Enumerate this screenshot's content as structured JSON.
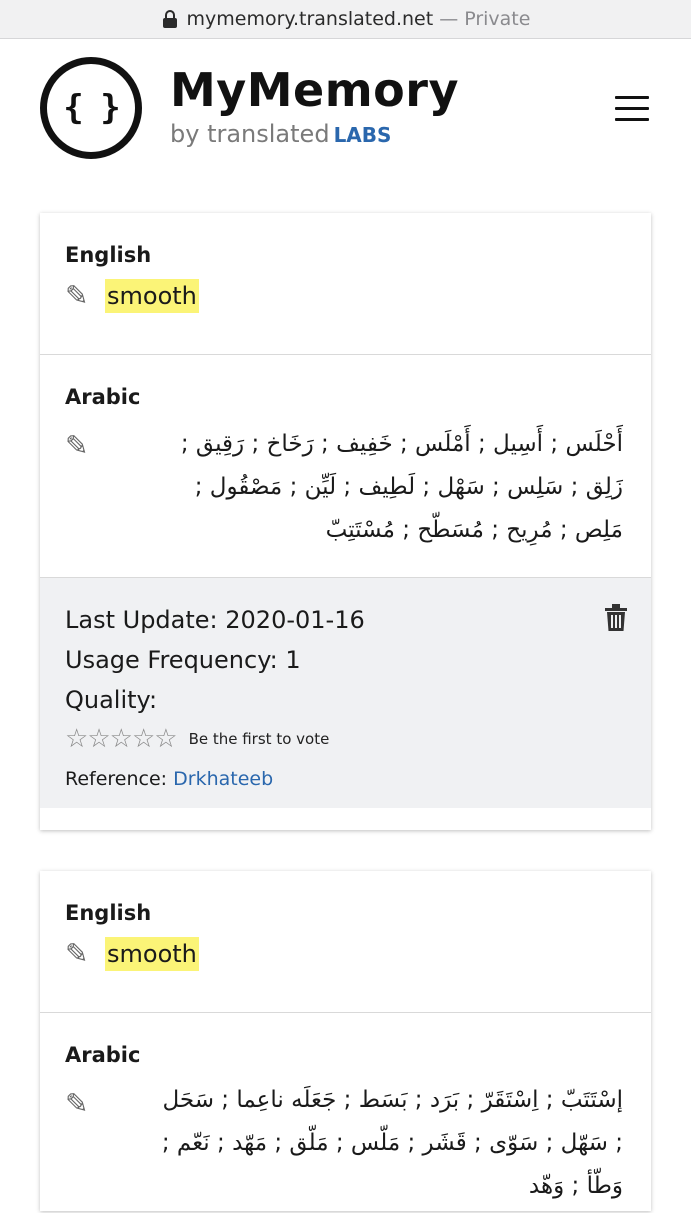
{
  "browser": {
    "url": "mymemory.translated.net",
    "separator": "—",
    "mode": "Private"
  },
  "header": {
    "logo_text": "{ }",
    "title": "MyMemory",
    "subtitle": "by translated",
    "subtitle_labs": "LABS"
  },
  "entries": [
    {
      "source_lang": "English",
      "source_text": "smooth",
      "target_lang": "Arabic",
      "target_text": "أَحْلَس ; أَسِيل ; أَمْلَس ; خَفِيف ; رَخَاخ ; رَقِيق ; زَلِق ; سَلِس ; سَهْل ; لَطِيف ; لَيِّن ; مَصْقُول ; مَلِص ; مُرِيح ; مُسَطّح ; مُسْتَتِبّ",
      "last_update_label": "Last Update:",
      "last_update": "2020-01-16",
      "usage_label": "Usage Frequency:",
      "usage": "1",
      "quality_label": "Quality:",
      "vote_text": "Be the first to vote",
      "rating": 0,
      "reference_label": "Reference:",
      "reference": "Drkhateeb"
    },
    {
      "source_lang": "English",
      "source_text": "smooth",
      "target_lang": "Arabic",
      "target_text": "إسْتَتَبّ ; اِسْتَقَرّ ; بَرَد ; بَسَط ; جَعَلَه ناعِما ; سَحَل ; سَهّل ; سَوّى ; قَشَر ; مَلّس ; مَلّق ; مَهّد ; نَعّم ; وَطّأ ; وَهّد"
    }
  ],
  "colors": {
    "highlight": "#fbf477",
    "link": "#2a67ad",
    "meta_bg": "#f0f1f3"
  },
  "icons": {
    "edit": "pencil-icon",
    "delete": "trash-icon",
    "menu": "hamburger-icon",
    "lock": "lock-icon"
  }
}
